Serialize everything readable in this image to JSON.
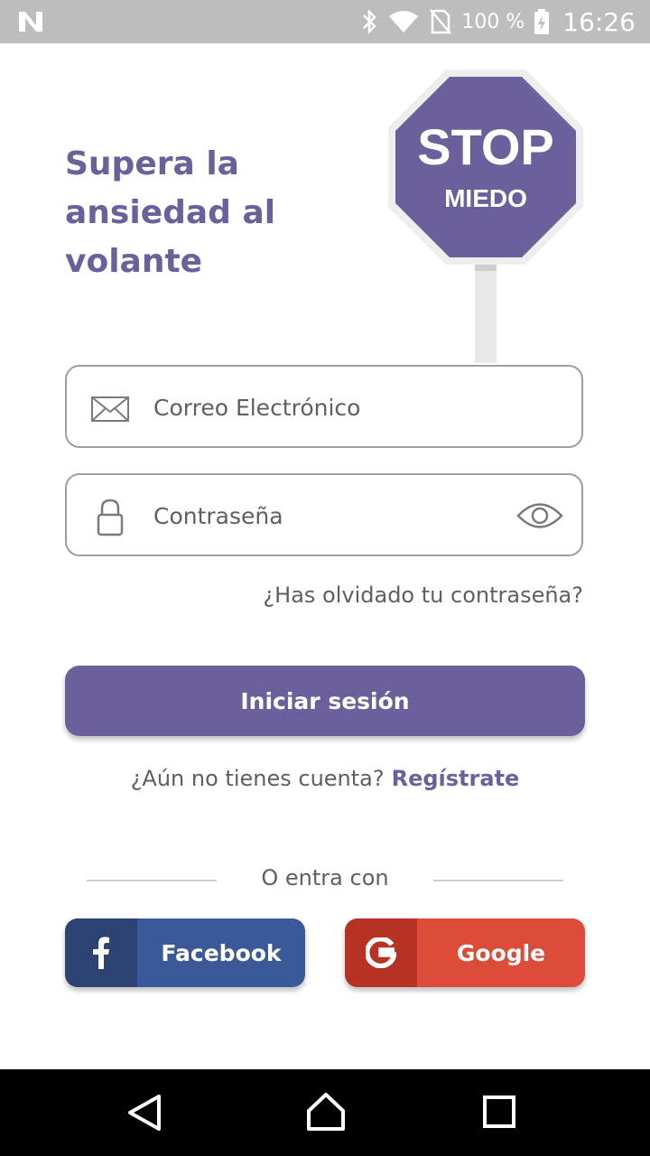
{
  "status_bar": {
    "battery_percent": "100 %",
    "time": "16:26",
    "icons": [
      "notification-n-icon",
      "bluetooth-icon",
      "wifi-icon",
      "no-sim-icon",
      "battery-icon"
    ]
  },
  "header": {
    "title": "Supera la ansiedad al volante",
    "sign_line1": "STOP",
    "sign_line2": "MIEDO"
  },
  "login_form": {
    "email_placeholder": "Correo Electrónico",
    "password_placeholder": "Contraseña",
    "forgot_password": "¿Has olvidado tu contraseña?",
    "login_button": "Iniciar sesión"
  },
  "register": {
    "prompt": "¿Aún no tienes cuenta?",
    "link": "Regístrate"
  },
  "social": {
    "divider_text": "O entra con",
    "facebook_label": "Facebook",
    "google_label": "Google"
  },
  "colors": {
    "primary": "#6b5f9c",
    "facebook": "#3b5998",
    "google": "#dd4b39",
    "status_bar": "#bdbdbd"
  }
}
